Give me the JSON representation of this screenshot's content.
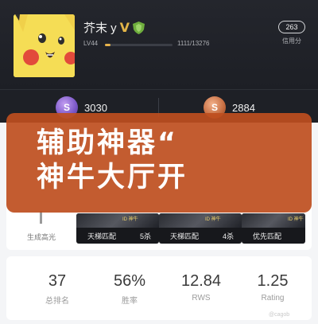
{
  "profile": {
    "username": "芥末 y",
    "rank_badge": "V",
    "level_label": "LV44",
    "exp_text": "1111/13276",
    "exp_progress": 0.084,
    "credit_score": "263",
    "credit_label": "信用分"
  },
  "currencies": [
    {
      "icon": "purple-s-coin-icon",
      "value": "3030"
    },
    {
      "icon": "bronze-s-coin-icon",
      "value": "2884"
    }
  ],
  "banner": {
    "line1": "辅助神器“",
    "line2": "神牛大厅开"
  },
  "highlights": {
    "label": "生成高光"
  },
  "matches": [
    {
      "type": "天梯匹配",
      "kills": "5杀",
      "tag": "ID 神牛"
    },
    {
      "type": "天梯匹配",
      "kills": "4杀",
      "tag": "ID 神牛"
    },
    {
      "type": "优先匹配",
      "kills": "",
      "tag": "ID 神牛"
    }
  ],
  "stats": [
    {
      "value": "37",
      "label": "总排名"
    },
    {
      "value": "56%",
      "label": "胜率"
    },
    {
      "value": "12.84",
      "label": "RWS"
    },
    {
      "value": "1.25",
      "label": "Rating"
    }
  ],
  "watermark": "@cagob",
  "colors": {
    "header_bg": "#1e2026",
    "overlay": "#be4e1e",
    "accent_gold": "#e7b34b"
  }
}
